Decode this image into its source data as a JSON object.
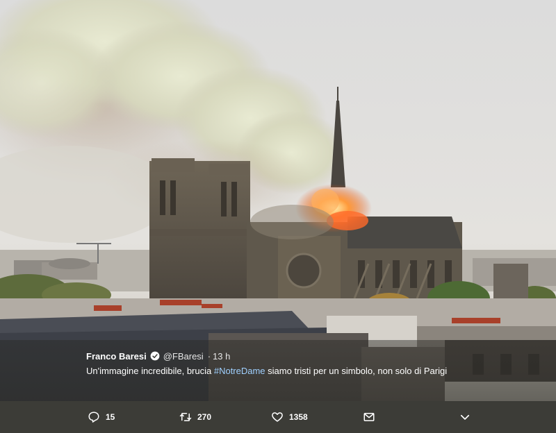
{
  "tweet": {
    "author_name": "Franco Baresi",
    "verified": true,
    "handle": "@FBaresi",
    "separator": "·",
    "time": "13 h",
    "text_part1": "Un'immagine incredibile, brucia ",
    "hashtag": "#NotreDame",
    "text_part2": " siamo tristi per un simbolo, non solo di Parigi"
  },
  "actions": {
    "reply_count": "15",
    "retweet_count": "270",
    "like_count": "1358"
  },
  "icons": {
    "reply": "reply-icon",
    "retweet": "retweet-icon",
    "like": "heart-icon",
    "dm": "envelope-icon",
    "more": "chevron-down-icon"
  },
  "colors": {
    "hashtag": "#9fd0ff",
    "verified": "#ffffff",
    "action_bar": "#3c3c37"
  }
}
